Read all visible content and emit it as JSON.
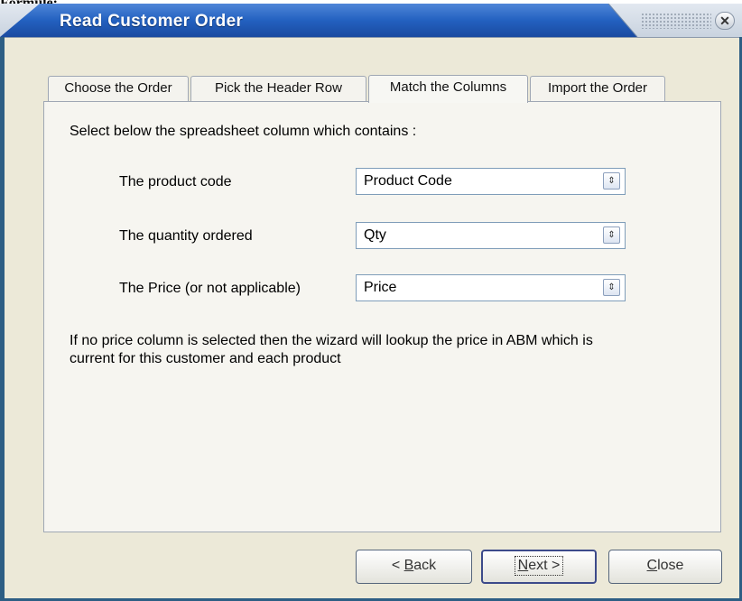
{
  "window": {
    "title": "Read Customer Order",
    "close_glyph": "✕",
    "top_fragment": "Formule:"
  },
  "tabs": [
    {
      "label": "Choose the Order",
      "active": false
    },
    {
      "label": "Pick the Header Row",
      "active": false
    },
    {
      "label": "Match the Columns",
      "active": true
    },
    {
      "label": "Import the Order",
      "active": false
    }
  ],
  "panel": {
    "instruction": "Select below the spreadsheet column which contains :",
    "fields": [
      {
        "label": "The product code",
        "value": "Product Code"
      },
      {
        "label": "The quantity ordered",
        "value": "Qty"
      },
      {
        "label": "The Price (or not applicable)",
        "value": "Price"
      }
    ],
    "note_line1": "If no price column is selected then the wizard will lookup the price in ABM which is",
    "note_line2": "current for this customer and each product"
  },
  "buttons": {
    "back": {
      "prefix": "< ",
      "mnemonic": "B",
      "rest": "ack"
    },
    "next": {
      "mnemonic": "N",
      "rest": "ext >"
    },
    "close": {
      "mnemonic": "C",
      "rest": "lose"
    }
  },
  "icons": {
    "combo_arrow": "⇕",
    "combo_icon_name": "up-down-arrows-icon",
    "close_icon_name": "close-icon"
  },
  "colors": {
    "titlebar_accent": "#1c58b5",
    "frame": "#2d5e84",
    "dialog_background": "#ece9d8"
  }
}
